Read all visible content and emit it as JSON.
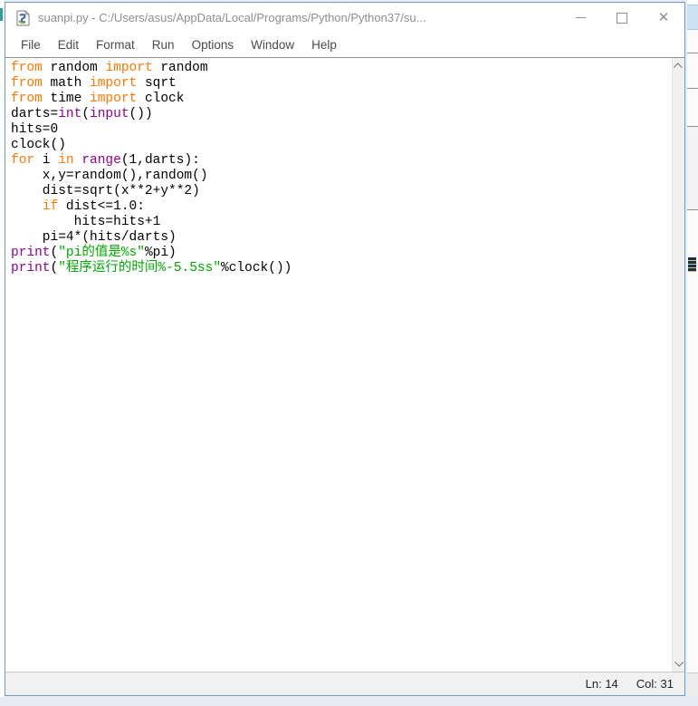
{
  "window": {
    "title": "suanpi.py - C:/Users/asus/AppData/Local/Programs/Python/Python37/su...",
    "controls": [
      "minimize-icon",
      "maximize-icon",
      "close-icon"
    ]
  },
  "menu": {
    "items": [
      "File",
      "Edit",
      "Format",
      "Run",
      "Options",
      "Window",
      "Help"
    ]
  },
  "editor": {
    "colors": {
      "keyword": "#ff7700",
      "builtin": "#900090",
      "string": "#00aa00",
      "plain": "#000000"
    },
    "lines": [
      [
        {
          "t": "from",
          "c": "keyword"
        },
        {
          "t": " random ",
          "c": "plain"
        },
        {
          "t": "import",
          "c": "keyword"
        },
        {
          "t": " random",
          "c": "plain"
        }
      ],
      [
        {
          "t": "from",
          "c": "keyword"
        },
        {
          "t": " math ",
          "c": "plain"
        },
        {
          "t": "import",
          "c": "keyword"
        },
        {
          "t": " sqrt",
          "c": "plain"
        }
      ],
      [
        {
          "t": "from",
          "c": "keyword"
        },
        {
          "t": " time ",
          "c": "plain"
        },
        {
          "t": "import",
          "c": "keyword"
        },
        {
          "t": " clock",
          "c": "plain"
        }
      ],
      [
        {
          "t": "darts=",
          "c": "plain"
        },
        {
          "t": "int",
          "c": "builtin"
        },
        {
          "t": "(",
          "c": "plain"
        },
        {
          "t": "input",
          "c": "builtin"
        },
        {
          "t": "())",
          "c": "plain"
        }
      ],
      [
        {
          "t": "hits=0",
          "c": "plain"
        }
      ],
      [
        {
          "t": "clock()",
          "c": "plain"
        }
      ],
      [
        {
          "t": "for",
          "c": "keyword"
        },
        {
          "t": " i ",
          "c": "plain"
        },
        {
          "t": "in",
          "c": "keyword"
        },
        {
          "t": " ",
          "c": "plain"
        },
        {
          "t": "range",
          "c": "builtin"
        },
        {
          "t": "(1,darts):",
          "c": "plain"
        }
      ],
      [
        {
          "t": "    x,y=random(),random()",
          "c": "plain"
        }
      ],
      [
        {
          "t": "    dist=sqrt(x**2+y**2)",
          "c": "plain"
        }
      ],
      [
        {
          "t": "    ",
          "c": "plain"
        },
        {
          "t": "if",
          "c": "keyword"
        },
        {
          "t": " dist<=1.0:",
          "c": "plain"
        }
      ],
      [
        {
          "t": "        hits=hits+1",
          "c": "plain"
        }
      ],
      [
        {
          "t": "    pi=4*(hits/darts)",
          "c": "plain"
        }
      ],
      [
        {
          "t": "print",
          "c": "builtin"
        },
        {
          "t": "(",
          "c": "plain"
        },
        {
          "t": "\"pi的值是%s\"",
          "c": "string"
        },
        {
          "t": "%pi)",
          "c": "plain"
        }
      ],
      [
        {
          "t": "print",
          "c": "builtin"
        },
        {
          "t": "(",
          "c": "plain"
        },
        {
          "t": "\"程序运行的时间%-5.5ss\"",
          "c": "string"
        },
        {
          "t": "%clock())",
          "c": "plain"
        }
      ]
    ]
  },
  "statusbar": {
    "line_label": "Ln: 14",
    "col_label": "Col: 31"
  }
}
